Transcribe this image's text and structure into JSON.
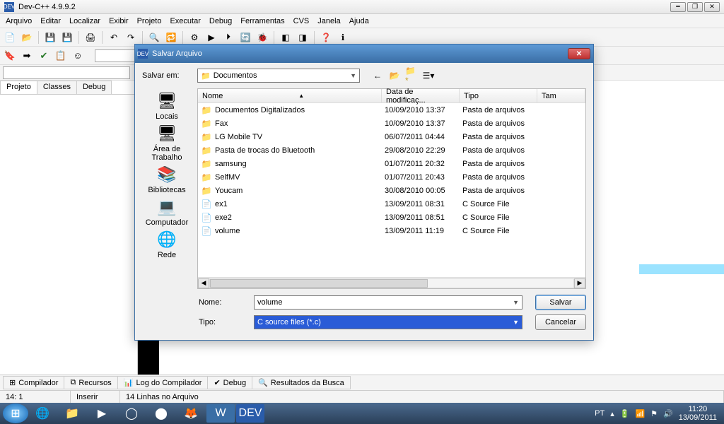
{
  "app": {
    "title": "Dev-C++ 4.9.9.2"
  },
  "menu": [
    "Arquivo",
    "Editar",
    "Localizar",
    "Exibir",
    "Projeto",
    "Executar",
    "Debug",
    "Ferramentas",
    "CVS",
    "Janela",
    "Ajuda"
  ],
  "side_tabs": [
    "Projeto",
    "Classes",
    "Debug"
  ],
  "bottom_tabs": [
    {
      "icon": "⊞",
      "label": "Compilador"
    },
    {
      "icon": "⧉",
      "label": "Recursos"
    },
    {
      "icon": "📊",
      "label": "Log do Compilador"
    },
    {
      "icon": "✔",
      "label": "Debug"
    },
    {
      "icon": "🔍",
      "label": "Resultados da Busca"
    }
  ],
  "status": {
    "pos": "14: 1",
    "mode": "Inserir",
    "info": "14 Linhas no Arquivo"
  },
  "taskbar": {
    "lang": "PT",
    "time": "11:20",
    "date": "13/09/2011"
  },
  "dialog": {
    "title": "Salvar Arquivo",
    "save_in_label": "Salvar em:",
    "save_in_value": "Documentos",
    "columns": {
      "nome": "Nome",
      "data": "Data de modificaç...",
      "tipo": "Tipo",
      "tam": "Tam"
    },
    "places": [
      {
        "icon": "🖥",
        "label": "Locais"
      },
      {
        "icon": "🖥",
        "label": "Área de Trabalho"
      },
      {
        "icon": "📚",
        "label": "Bibliotecas"
      },
      {
        "icon": "💻",
        "label": "Computador"
      },
      {
        "icon": "🌐",
        "label": "Rede"
      }
    ],
    "files": [
      {
        "icon": "folder",
        "name": "Documentos Digitalizados",
        "date": "10/09/2010 13:37",
        "type": "Pasta de arquivos"
      },
      {
        "icon": "folder",
        "name": "Fax",
        "date": "10/09/2010 13:37",
        "type": "Pasta de arquivos"
      },
      {
        "icon": "folder",
        "name": "LG Mobile TV",
        "date": "06/07/2011 04:44",
        "type": "Pasta de arquivos"
      },
      {
        "icon": "folder",
        "name": "Pasta de trocas do Bluetooth",
        "date": "29/08/2010 22:29",
        "type": "Pasta de arquivos"
      },
      {
        "icon": "folder",
        "name": "samsung",
        "date": "01/07/2011 20:32",
        "type": "Pasta de arquivos"
      },
      {
        "icon": "folder",
        "name": "SelfMV",
        "date": "01/07/2011 20:43",
        "type": "Pasta de arquivos"
      },
      {
        "icon": "folder",
        "name": "Youcam",
        "date": "30/08/2010 00:05",
        "type": "Pasta de arquivos"
      },
      {
        "icon": "cfile",
        "name": "ex1",
        "date": "13/09/2011 08:31",
        "type": "C Source File"
      },
      {
        "icon": "cfile",
        "name": "exe2",
        "date": "13/09/2011 08:51",
        "type": "C Source File"
      },
      {
        "icon": "cfile",
        "name": "volume",
        "date": "13/09/2011 11:19",
        "type": "C Source File"
      }
    ],
    "name_label": "Nome:",
    "name_value": "volume",
    "type_label": "Tipo:",
    "type_value": "C source files (*.c)",
    "save_btn": "Salvar",
    "cancel_btn": "Cancelar"
  }
}
